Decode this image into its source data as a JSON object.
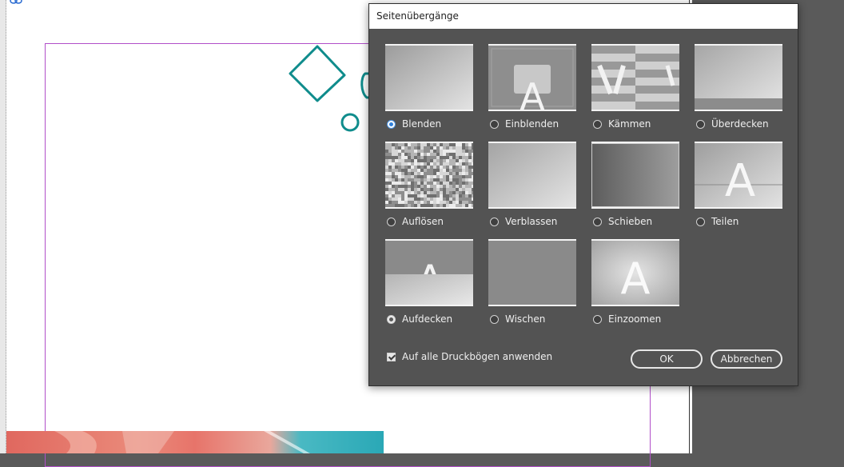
{
  "dialog": {
    "title": "Seitenübergänge",
    "transitions": [
      {
        "label": "Blenden",
        "selected": true
      },
      {
        "label": "Einblenden",
        "selected": false
      },
      {
        "label": "Kämmen",
        "selected": false
      },
      {
        "label": "Überdecken",
        "selected": false
      },
      {
        "label": "Auflösen",
        "selected": false
      },
      {
        "label": "Verblassen",
        "selected": false
      },
      {
        "label": "Schieben",
        "selected": false
      },
      {
        "label": "Teilen",
        "selected": false
      },
      {
        "label": "Aufdecken",
        "selected": false
      },
      {
        "label": "Wischen",
        "selected": false
      },
      {
        "label": "Einzoomen",
        "selected": false
      }
    ],
    "preview_glyph": "A",
    "apply_all_label": "Auf alle Druckbögen anwenden",
    "apply_all_checked": true,
    "ok_label": "OK",
    "cancel_label": "Abbrechen"
  },
  "colors": {
    "dialog_bg": "#535353",
    "accent": "#2f80db",
    "guide": "#b14fc9",
    "shape_stroke": "#0f8c8c"
  }
}
